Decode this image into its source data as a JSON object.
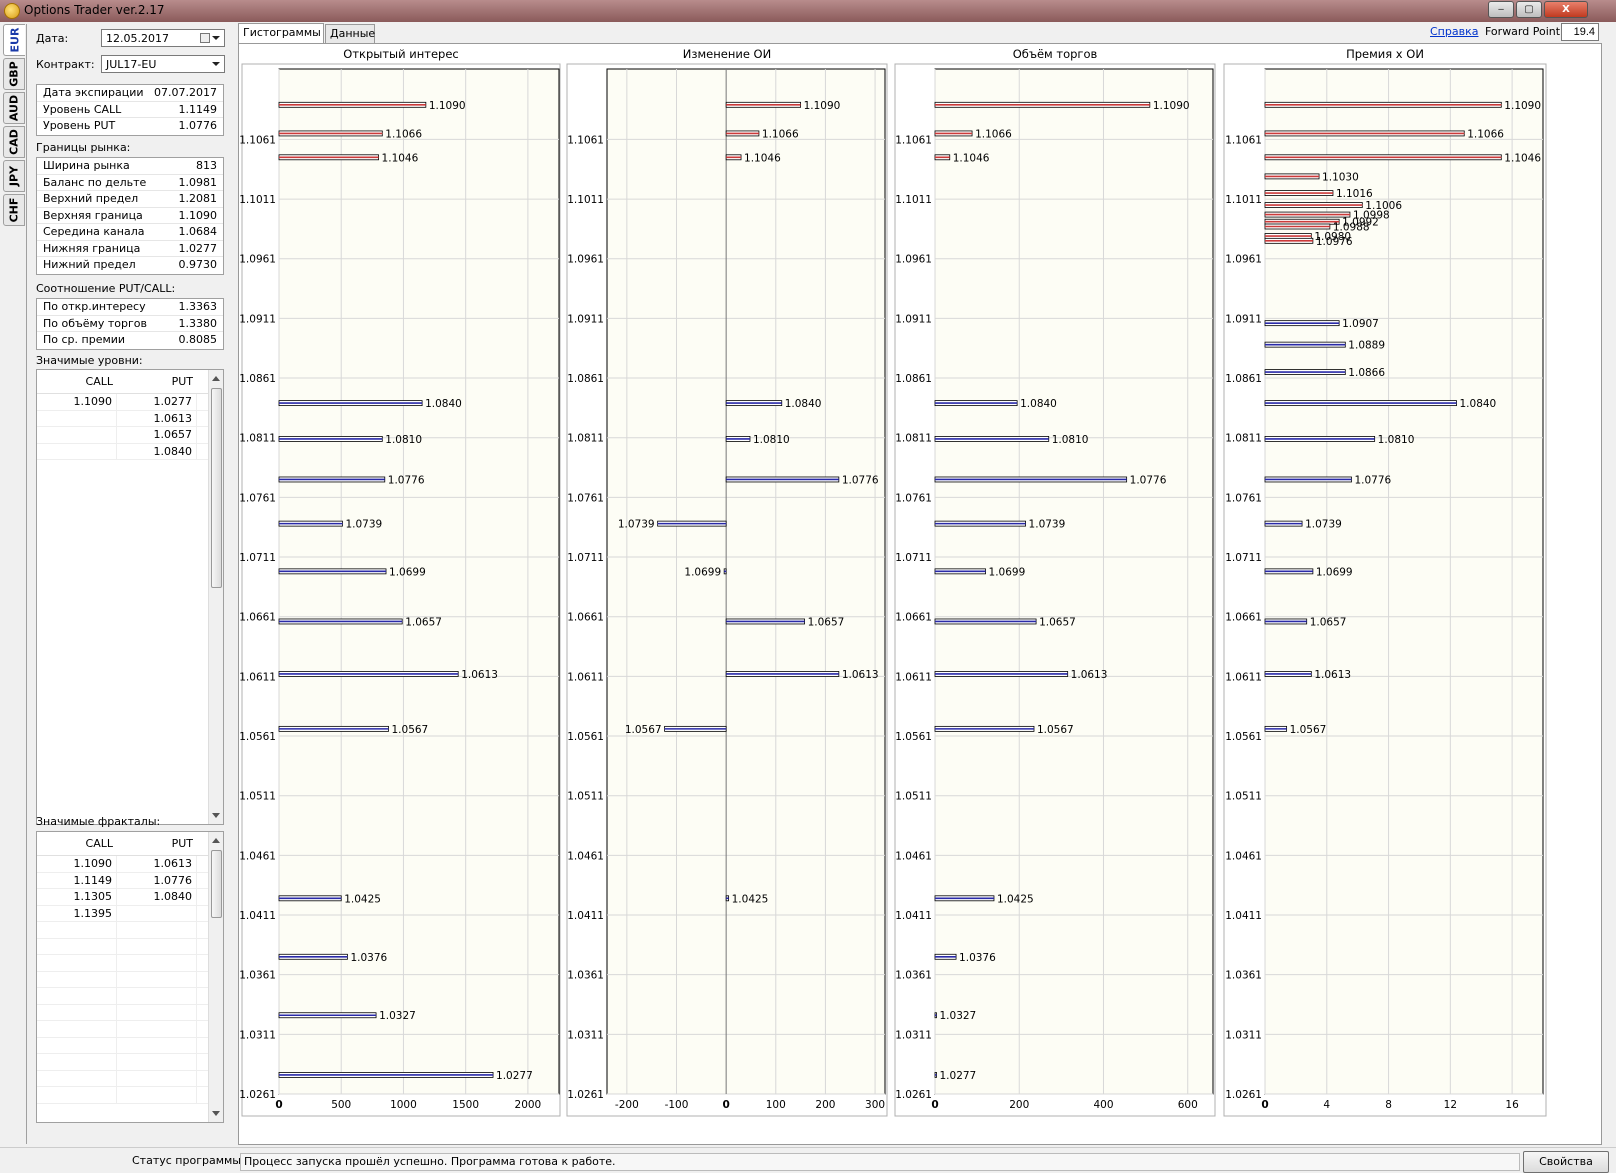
{
  "window": {
    "title": "Options Trader ver.2.17",
    "min_label": "‒",
    "max_label": "▢",
    "close_label": "X"
  },
  "currency_tabs": [
    "EUR",
    "GBP",
    "AUD",
    "CAD",
    "JPY",
    "CHF"
  ],
  "left": {
    "date_label": "Дата:",
    "date_value": "12.05.2017",
    "contract_label": "Контракт:",
    "contract_value": "JUL17-EU",
    "expiry": [
      {
        "label": "Дата экспирации",
        "value": "07.07.2017"
      },
      {
        "label": "Уровень CALL",
        "value": "1.1149"
      },
      {
        "label": "Уровень PUT",
        "value": "1.0776"
      }
    ],
    "bounds_title": "Границы рынка:",
    "bounds": [
      {
        "label": "Ширина рынка",
        "value": "813"
      },
      {
        "label": "Баланс по дельте",
        "value": "1.0981"
      },
      {
        "label": "Верхний предел",
        "value": "1.2081"
      },
      {
        "label": "Верхняя граница",
        "value": "1.1090"
      },
      {
        "label": "Середина канала",
        "value": "1.0684"
      },
      {
        "label": "Нижняя граница",
        "value": "1.0277"
      },
      {
        "label": "Нижний предел",
        "value": "0.9730"
      }
    ],
    "ratio_title": "Соотношение PUT/CALL:",
    "ratio": [
      {
        "label": "По откр.интересу",
        "value": "1.3363"
      },
      {
        "label": "По объёму торгов",
        "value": "1.3380"
      },
      {
        "label": "По ср. премии",
        "value": "0.8085"
      }
    ],
    "levels_title": "Значимые уровни:",
    "levels_headers": [
      "CALL",
      "PUT"
    ],
    "levels_rows": [
      [
        "1.1090",
        "1.0277"
      ],
      [
        "",
        "1.0613"
      ],
      [
        "",
        "1.0657"
      ],
      [
        "",
        "1.0840"
      ]
    ],
    "fractals_title": "Значимые фракталы:",
    "fractals_headers": [
      "CALL",
      "PUT"
    ],
    "fractals_rows": [
      [
        "1.1090",
        "1.0613"
      ],
      [
        "1.1149",
        "1.0776"
      ],
      [
        "1.1305",
        "1.0840"
      ],
      [
        "1.1395",
        ""
      ]
    ]
  },
  "tabs": [
    "Гистограммы",
    "Данные"
  ],
  "help_link": "Справка",
  "forward_point_label": "Forward Point:",
  "forward_point_value": "19.4",
  "status": {
    "label": "Статус программы:",
    "text": "Процесс запуска прошёл успешно. Программа готова к работе.",
    "button": "Свойства"
  },
  "colors": {
    "call_bar": "#cc3a3a",
    "put_bar": "#2a2aa8",
    "plot_bg": "#fdfdf5",
    "grid": "#d8d8d8"
  },
  "chart_data": [
    {
      "type": "bar",
      "orientation": "horizontal",
      "title": "Открытый интерес",
      "ylim": [
        1.0261,
        1.112
      ],
      "yticks": [
        "1.1061",
        "1.1011",
        "1.0961",
        "1.0911",
        "1.0861",
        "1.0811",
        "1.0761",
        "1.0711",
        "1.0661",
        "1.0611",
        "1.0561",
        "1.0511",
        "1.0461",
        "1.0411",
        "1.0361",
        "1.0311",
        "1.0261"
      ],
      "xlim": [
        0,
        2250
      ],
      "xticks": [
        0,
        500,
        1000,
        1500,
        2000
      ],
      "series": [
        {
          "name": "CALL",
          "points": [
            {
              "y": 1.109,
              "v": 1180
            },
            {
              "y": 1.1066,
              "v": 830
            },
            {
              "y": 1.1046,
              "v": 800
            }
          ]
        },
        {
          "name": "PUT",
          "points": [
            {
              "y": 1.084,
              "v": 1150
            },
            {
              "y": 1.081,
              "v": 830
            },
            {
              "y": 1.0776,
              "v": 850
            },
            {
              "y": 1.0739,
              "v": 510
            },
            {
              "y": 1.0699,
              "v": 860
            },
            {
              "y": 1.0657,
              "v": 990
            },
            {
              "y": 1.0613,
              "v": 1440
            },
            {
              "y": 1.0567,
              "v": 880
            },
            {
              "y": 1.0425,
              "v": 500
            },
            {
              "y": 1.0376,
              "v": 550
            },
            {
              "y": 1.0327,
              "v": 780
            },
            {
              "y": 1.0277,
              "v": 1720
            }
          ]
        }
      ]
    },
    {
      "type": "bar",
      "orientation": "horizontal",
      "title": "Изменение ОИ",
      "ylim": [
        1.0261,
        1.112
      ],
      "yticks": [
        "1.1061",
        "1.1011",
        "1.0961",
        "1.0911",
        "1.0861",
        "1.0811",
        "1.0761",
        "1.0711",
        "1.0661",
        "1.0611",
        "1.0561",
        "1.0511",
        "1.0461",
        "1.0411",
        "1.0361",
        "1.0311",
        "1.0261"
      ],
      "xlim": [
        -240,
        320
      ],
      "xticks": [
        -200,
        -100,
        0,
        100,
        200,
        300
      ],
      "series": [
        {
          "name": "CALL",
          "points": [
            {
              "y": 1.109,
              "v": 150
            },
            {
              "y": 1.1066,
              "v": 66
            },
            {
              "y": 1.1046,
              "v": 30
            }
          ]
        },
        {
          "name": "PUT",
          "points": [
            {
              "y": 1.084,
              "v": 112
            },
            {
              "y": 1.081,
              "v": 48
            },
            {
              "y": 1.0776,
              "v": 227
            },
            {
              "y": 1.0739,
              "v": -138
            },
            {
              "y": 1.0699,
              "v": -4
            },
            {
              "y": 1.0657,
              "v": 158
            },
            {
              "y": 1.0613,
              "v": 227
            },
            {
              "y": 1.0567,
              "v": -124
            },
            {
              "y": 1.0425,
              "v": 5
            }
          ]
        }
      ]
    },
    {
      "type": "bar",
      "orientation": "horizontal",
      "title": "Объём торгов",
      "ylim": [
        1.0261,
        1.112
      ],
      "yticks": [
        "1.1061",
        "1.1011",
        "1.0961",
        "1.0911",
        "1.0861",
        "1.0811",
        "1.0761",
        "1.0711",
        "1.0661",
        "1.0611",
        "1.0561",
        "1.0511",
        "1.0461",
        "1.0411",
        "1.0361",
        "1.0311",
        "1.0261"
      ],
      "xlim": [
        0,
        660
      ],
      "xticks": [
        0,
        200,
        400,
        600
      ],
      "series": [
        {
          "name": "CALL",
          "points": [
            {
              "y": 1.109,
              "v": 510
            },
            {
              "y": 1.1066,
              "v": 88
            },
            {
              "y": 1.1046,
              "v": 35
            }
          ]
        },
        {
          "name": "PUT",
          "points": [
            {
              "y": 1.084,
              "v": 195
            },
            {
              "y": 1.081,
              "v": 270
            },
            {
              "y": 1.0776,
              "v": 455
            },
            {
              "y": 1.0739,
              "v": 215
            },
            {
              "y": 1.0699,
              "v": 120
            },
            {
              "y": 1.0657,
              "v": 240
            },
            {
              "y": 1.0613,
              "v": 315
            },
            {
              "y": 1.0567,
              "v": 235
            },
            {
              "y": 1.0425,
              "v": 140
            },
            {
              "y": 1.0376,
              "v": 50
            },
            {
              "y": 1.0327,
              "v": 3
            },
            {
              "y": 1.0277,
              "v": 2
            }
          ]
        }
      ]
    },
    {
      "type": "bar",
      "orientation": "horizontal",
      "title": "Премия х ОИ",
      "ylim": [
        1.0261,
        1.112
      ],
      "yticks": [
        "1.1061",
        "1.1011",
        "1.0961",
        "1.0911",
        "1.0861",
        "1.0811",
        "1.0761",
        "1.0711",
        "1.0661",
        "1.0611",
        "1.0561",
        "1.0511",
        "1.0461",
        "1.0411",
        "1.0361",
        "1.0311",
        "1.0261"
      ],
      "xlim": [
        0,
        18
      ],
      "xticks": [
        0,
        4,
        8,
        12,
        16
      ],
      "series": [
        {
          "name": "CALL",
          "points": [
            {
              "y": 1.109,
              "v": 15.3
            },
            {
              "y": 1.1066,
              "v": 12.9
            },
            {
              "y": 1.1046,
              "v": 15.3
            },
            {
              "y": 1.103,
              "v": 3.5
            },
            {
              "y": 1.1016,
              "v": 4.4
            },
            {
              "y": 1.1006,
              "v": 6.3
            },
            {
              "y": 1.0998,
              "v": 5.5
            },
            {
              "y": 1.0992,
              "v": 4.8
            },
            {
              "y": 1.0988,
              "v": 4.2
            },
            {
              "y": 1.098,
              "v": 3.0
            },
            {
              "y": 1.0976,
              "v": 3.1
            }
          ]
        },
        {
          "name": "PUT",
          "points": [
            {
              "y": 1.0907,
              "v": 4.8
            },
            {
              "y": 1.0889,
              "v": 5.2
            },
            {
              "y": 1.0866,
              "v": 5.2
            },
            {
              "y": 1.084,
              "v": 12.4
            },
            {
              "y": 1.081,
              "v": 7.1
            },
            {
              "y": 1.0776,
              "v": 5.6
            },
            {
              "y": 1.0739,
              "v": 2.4
            },
            {
              "y": 1.0699,
              "v": 3.1
            },
            {
              "y": 1.0657,
              "v": 2.7
            },
            {
              "y": 1.0613,
              "v": 3.0
            },
            {
              "y": 1.0567,
              "v": 1.4
            }
          ]
        }
      ]
    }
  ]
}
